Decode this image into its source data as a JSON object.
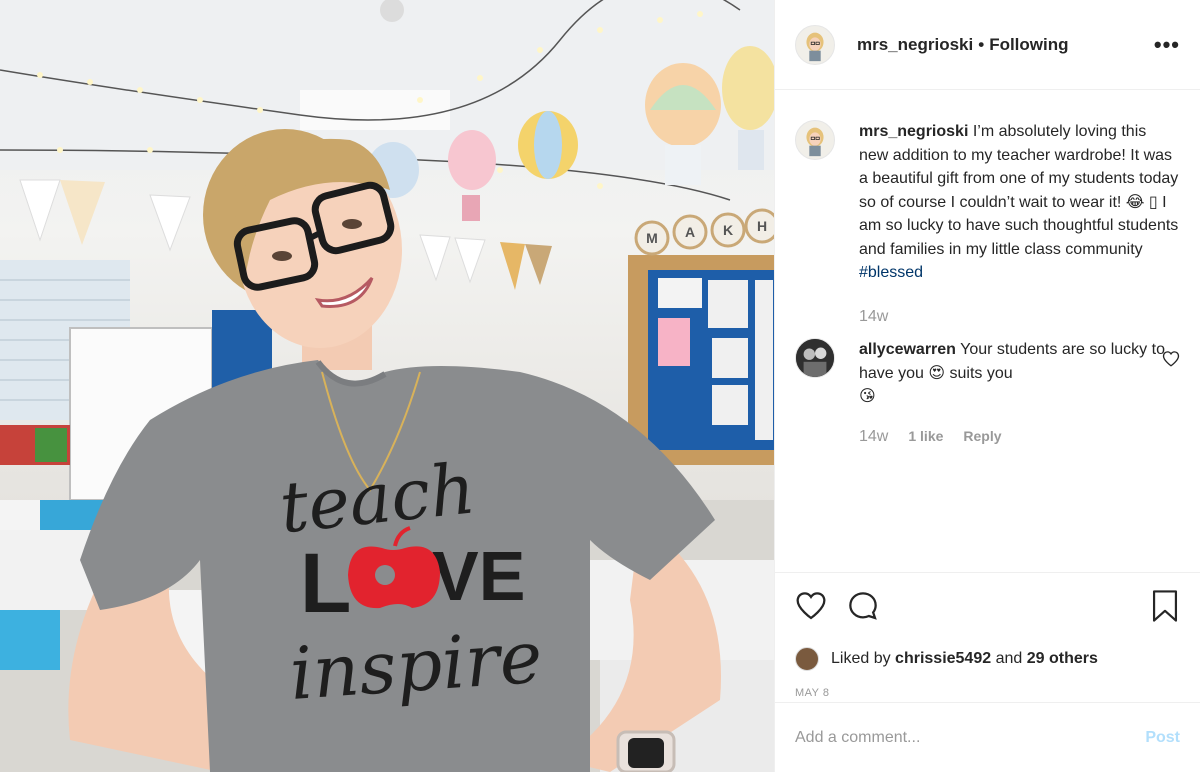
{
  "post": {
    "author": "mrs_negrioski",
    "separator": "•",
    "follow_status": "Following",
    "more_icon": "more-options-icon",
    "shirt_text": {
      "line1": "teach",
      "line2_left": "L",
      "line2_right": "VE",
      "line3": "inspire"
    },
    "bunting_letters": [
      "M",
      "A",
      "K",
      "H"
    ]
  },
  "caption": {
    "user": "mrs_negrioski",
    "text": "I’m absolutely loving this new addition to my teacher wardrobe! It was a beautiful gift from one of my students today so of course I couldn’t wait to wear it! 😂 ▯ I am so lucky to have such thoughtful students and families in my little class community",
    "hashtag": "#blessed",
    "age": "14w"
  },
  "comment": {
    "user": "allycewarren",
    "text": "Your students are so lucky to have you 😍 suits you",
    "emoji": "😘",
    "age": "14w",
    "likes": "1 like",
    "reply": "Reply"
  },
  "engagement": {
    "liked_by_prefix": "Liked by",
    "liked_by_user": "chrissie5492",
    "and": "and",
    "others": "29 others",
    "date": "MAY 8"
  },
  "composer": {
    "placeholder": "Add a comment...",
    "post_label": "Post"
  },
  "colors": {
    "link": "#003569",
    "post_disabled": "#b2dffc",
    "muted": "#999999",
    "text": "#262626",
    "shirt": "#8a8c8e",
    "apple": "#e2232e"
  }
}
